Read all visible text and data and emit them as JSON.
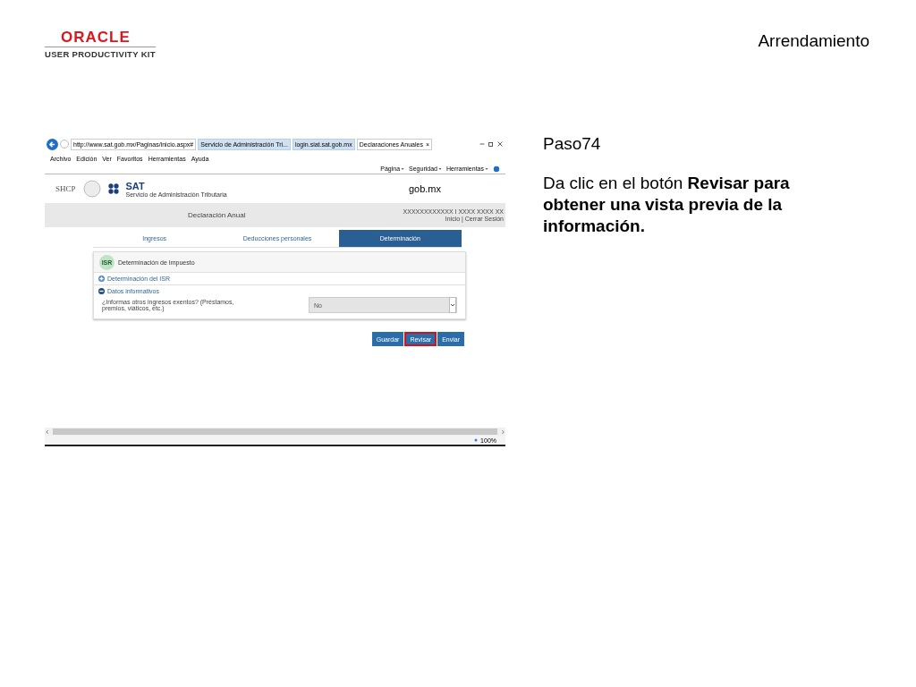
{
  "logo": {
    "brand": "ORACLE",
    "product": "USER PRODUCTIVITY KIT"
  },
  "page_title": "Arrendamiento",
  "browser": {
    "address": "http://www.sat.gob.mx/Paginas/inicio.aspx#",
    "tabs": [
      {
        "label": "Servicio de Administración Tri...",
        "selected": false
      },
      {
        "label": "login.siat.sat.gob.mx",
        "selected": false
      },
      {
        "label": "Declaraciones Anuales",
        "selected": true,
        "close": "×"
      }
    ],
    "menu": [
      "Archivo",
      "Edición",
      "Ver",
      "Favoritos",
      "Herramientas",
      "Ayuda"
    ],
    "toolbar": [
      "Página",
      "Seguridad",
      "Herramientas"
    ],
    "zoom": "100%"
  },
  "site": {
    "shcp": "SHCP",
    "sat": "SAT",
    "sat_subtitle": "Servicio de Administración Tributaria",
    "gob": "gob.mx",
    "banner_title": "Declaración Anual",
    "user": "XXXXXXXXXXXX I XXXX XXXX XX",
    "session_links": "Inicio | Cerrar Sesión",
    "tabs": [
      {
        "label": "Ingresos",
        "selected": false
      },
      {
        "label": "Deducciones personales",
        "selected": false
      },
      {
        "label": "Determinación",
        "selected": true
      }
    ],
    "card": {
      "badge": "ISR",
      "title": "Determinación de Impuesto",
      "sections": [
        {
          "label": "Determinación del ISR",
          "expanded": false
        },
        {
          "label": "Datos informativos",
          "expanded": true
        }
      ],
      "question": "¿Informas otros ingresos exentos? (Préstamos, premios, viáticos, etc.)",
      "answer": "No"
    },
    "buttons": [
      {
        "label": "Guardar",
        "highlighted": false
      },
      {
        "label": "Revisar",
        "highlighted": true
      },
      {
        "label": "Enviar",
        "highlighted": false
      }
    ]
  },
  "step": "Paso74",
  "instruction": "Da clic en el botón  **Revisar para obtener una vista previa de la información.**"
}
